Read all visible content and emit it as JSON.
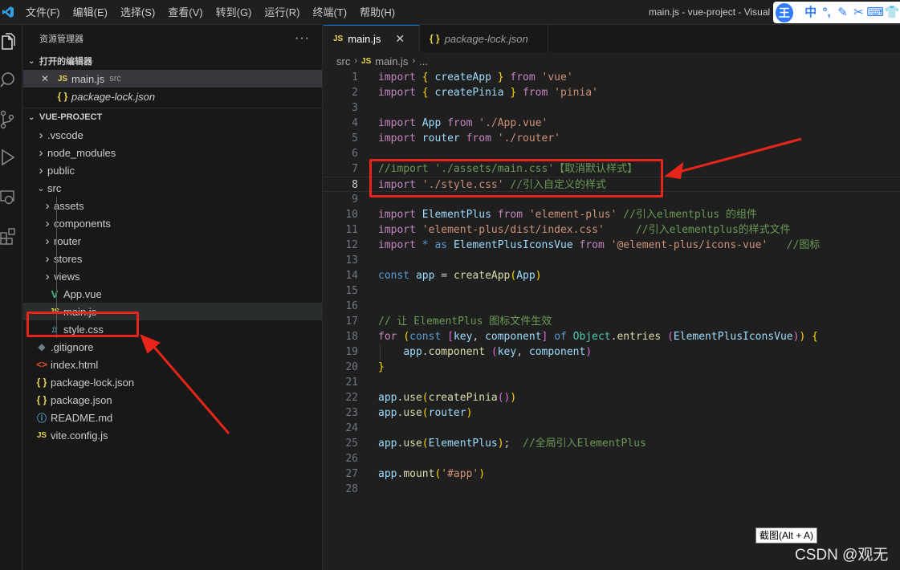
{
  "titlebar": {
    "menu": [
      "文件(F)",
      "编辑(E)",
      "选择(S)",
      "查看(V)",
      "转到(G)",
      "运行(R)",
      "终端(T)",
      "帮助(H)"
    ],
    "window_title": "main.js - vue-project - Visual S",
    "ime": {
      "logo": "王",
      "buttons": [
        "中",
        "°,",
        "✎",
        "✂",
        "⌨",
        "👕"
      ]
    }
  },
  "activitybar": {
    "icons": [
      "explorer-icon",
      "search-icon",
      "source-control-icon",
      "run-debug-icon",
      "remote-explorer-icon",
      "extensions-icon"
    ]
  },
  "sidebar": {
    "title": "资源管理器",
    "more": "···",
    "open_editors": {
      "label": "打开的编辑器",
      "items": [
        {
          "close": "✕",
          "icon": "JS",
          "name": "main.js",
          "desc": "src"
        },
        {
          "icon": "{ }",
          "name": "package-lock.json"
        }
      ]
    },
    "project": {
      "label": "VUE-PROJECT",
      "items": [
        {
          "name": ".vscode",
          "type": "folder",
          "depth": 0
        },
        {
          "name": "node_modules",
          "type": "folder",
          "depth": 0
        },
        {
          "name": "public",
          "type": "folder",
          "depth": 0
        },
        {
          "name": "src",
          "type": "folder-open",
          "depth": 0
        },
        {
          "name": "assets",
          "type": "folder",
          "depth": 1
        },
        {
          "name": "components",
          "type": "folder",
          "depth": 1
        },
        {
          "name": "router",
          "type": "folder",
          "depth": 1
        },
        {
          "name": "stores",
          "type": "folder",
          "depth": 1
        },
        {
          "name": "views",
          "type": "folder",
          "depth": 1
        },
        {
          "name": "App.vue",
          "type": "vue",
          "depth": 1
        },
        {
          "name": "main.js",
          "type": "js",
          "depth": 1
        },
        {
          "name": "style.css",
          "type": "css",
          "depth": 1
        },
        {
          "name": ".gitignore",
          "type": "git",
          "depth": 0
        },
        {
          "name": "index.html",
          "type": "html",
          "depth": 0
        },
        {
          "name": "package-lock.json",
          "type": "json",
          "depth": 0
        },
        {
          "name": "package.json",
          "type": "json",
          "depth": 0
        },
        {
          "name": "README.md",
          "type": "info",
          "depth": 0
        },
        {
          "name": "vite.config.js",
          "type": "js",
          "depth": 0
        }
      ]
    }
  },
  "editor": {
    "tabs": [
      {
        "icon": "JS",
        "label": "main.js",
        "close": "✕"
      },
      {
        "icon": "{ }",
        "label": "package-lock.json"
      }
    ],
    "breadcrumb": {
      "folder": "src",
      "icon": "JS",
      "file": "main.js",
      "more": "..."
    },
    "current_line": 8,
    "lines": [
      [
        [
          "kw",
          "import"
        ],
        [
          "pun",
          " "
        ],
        [
          "br1",
          "{"
        ],
        [
          "pun",
          " "
        ],
        [
          "id",
          "createApp"
        ],
        [
          "pun",
          " "
        ],
        [
          "br1",
          "}"
        ],
        [
          "pun",
          " "
        ],
        [
          "kw",
          "from"
        ],
        [
          "pun",
          " "
        ],
        [
          "str",
          "'vue'"
        ]
      ],
      [
        [
          "kw",
          "import"
        ],
        [
          "pun",
          " "
        ],
        [
          "br1",
          "{"
        ],
        [
          "pun",
          " "
        ],
        [
          "id",
          "createPinia"
        ],
        [
          "pun",
          " "
        ],
        [
          "br1",
          "}"
        ],
        [
          "pun",
          " "
        ],
        [
          "kw",
          "from"
        ],
        [
          "pun",
          " "
        ],
        [
          "str",
          "'pinia'"
        ]
      ],
      [],
      [
        [
          "kw",
          "import"
        ],
        [
          "pun",
          " "
        ],
        [
          "id",
          "App"
        ],
        [
          "pun",
          " "
        ],
        [
          "kw",
          "from"
        ],
        [
          "pun",
          " "
        ],
        [
          "str",
          "'./App.vue'"
        ]
      ],
      [
        [
          "kw",
          "import"
        ],
        [
          "pun",
          " "
        ],
        [
          "id",
          "router"
        ],
        [
          "pun",
          " "
        ],
        [
          "kw",
          "from"
        ],
        [
          "pun",
          " "
        ],
        [
          "str",
          "'./router'"
        ]
      ],
      [],
      [
        [
          "cmt",
          "//import './assets/main.css'【取消默认样式】"
        ]
      ],
      [
        [
          "kw",
          "import"
        ],
        [
          "pun",
          " "
        ],
        [
          "str",
          "'./style.css'"
        ],
        [
          "pun",
          " "
        ],
        [
          "cmt",
          "//引入自定义的样式"
        ]
      ],
      [],
      [
        [
          "kw",
          "import"
        ],
        [
          "pun",
          " "
        ],
        [
          "id",
          "ElementPlus"
        ],
        [
          "pun",
          " "
        ],
        [
          "kw",
          "from"
        ],
        [
          "pun",
          " "
        ],
        [
          "str",
          "'element-plus'"
        ],
        [
          "pun",
          " "
        ],
        [
          "cmt",
          "//引入elmentplus 的组件"
        ]
      ],
      [
        [
          "kw",
          "import"
        ],
        [
          "pun",
          " "
        ],
        [
          "str",
          "'element-plus/dist/index.css'"
        ],
        [
          "pun",
          "     "
        ],
        [
          "cmt",
          "//引入elementplus的样式文件"
        ]
      ],
      [
        [
          "kw",
          "import"
        ],
        [
          "pun",
          " "
        ],
        [
          "kw2",
          "*"
        ],
        [
          "pun",
          " "
        ],
        [
          "kw2",
          "as"
        ],
        [
          "pun",
          " "
        ],
        [
          "id",
          "ElementPlusIconsVue"
        ],
        [
          "pun",
          " "
        ],
        [
          "kw",
          "from"
        ],
        [
          "pun",
          " "
        ],
        [
          "str",
          "'@element-plus/icons-vue'"
        ],
        [
          "pun",
          "   "
        ],
        [
          "cmt",
          "//图标"
        ]
      ],
      [],
      [
        [
          "kw2",
          "const"
        ],
        [
          "pun",
          " "
        ],
        [
          "id",
          "app"
        ],
        [
          "pun",
          " = "
        ],
        [
          "fn",
          "createApp"
        ],
        [
          "br1",
          "("
        ],
        [
          "id",
          "App"
        ],
        [
          "br1",
          ")"
        ]
      ],
      [],
      [],
      [
        [
          "cmt",
          "// 让 ElementPlus 图标文件生效"
        ]
      ],
      [
        [
          "kw",
          "for"
        ],
        [
          "pun",
          " "
        ],
        [
          "br1",
          "("
        ],
        [
          "kw2",
          "const"
        ],
        [
          "pun",
          " "
        ],
        [
          "br2",
          "["
        ],
        [
          "id",
          "key"
        ],
        [
          "pun",
          ", "
        ],
        [
          "id",
          "component"
        ],
        [
          "br2",
          "]"
        ],
        [
          "pun",
          " "
        ],
        [
          "kw2",
          "of"
        ],
        [
          "pun",
          " "
        ],
        [
          "cls",
          "Object"
        ],
        [
          "pun",
          "."
        ],
        [
          "fn",
          "entries"
        ],
        [
          "pun",
          " "
        ],
        [
          "br2",
          "("
        ],
        [
          "id",
          "ElementPlusIconsVue"
        ],
        [
          "br2",
          ")"
        ],
        [
          "br1",
          ")"
        ],
        [
          "pun",
          " "
        ],
        [
          "br1",
          "{"
        ]
      ],
      [
        [
          "pun",
          "    "
        ],
        [
          "id",
          "app"
        ],
        [
          "pun",
          "."
        ],
        [
          "fn",
          "component"
        ],
        [
          "pun",
          " "
        ],
        [
          "br2",
          "("
        ],
        [
          "id",
          "key"
        ],
        [
          "pun",
          ", "
        ],
        [
          "id",
          "component"
        ],
        [
          "br2",
          ")"
        ]
      ],
      [
        [
          "br1",
          "}"
        ]
      ],
      [],
      [
        [
          "id",
          "app"
        ],
        [
          "pun",
          "."
        ],
        [
          "fn",
          "use"
        ],
        [
          "br1",
          "("
        ],
        [
          "fn",
          "createPinia"
        ],
        [
          "br2",
          "()"
        ],
        [
          "br1",
          ")"
        ]
      ],
      [
        [
          "id",
          "app"
        ],
        [
          "pun",
          "."
        ],
        [
          "fn",
          "use"
        ],
        [
          "br1",
          "("
        ],
        [
          "id",
          "router"
        ],
        [
          "br1",
          ")"
        ]
      ],
      [],
      [
        [
          "id",
          "app"
        ],
        [
          "pun",
          "."
        ],
        [
          "fn",
          "use"
        ],
        [
          "br1",
          "("
        ],
        [
          "id",
          "ElementPlus"
        ],
        [
          "br1",
          ")"
        ],
        [
          "pun",
          ";  "
        ],
        [
          "cmt",
          "//全局引入ElementPlus"
        ]
      ],
      [],
      [
        [
          "id",
          "app"
        ],
        [
          "pun",
          "."
        ],
        [
          "fn",
          "mount"
        ],
        [
          "br1",
          "("
        ],
        [
          "str",
          "'#app'"
        ],
        [
          "br1",
          ")"
        ]
      ],
      []
    ]
  },
  "overlay": {
    "tooltip": "截图(Alt + A)",
    "watermark": "CSDN @观无"
  },
  "colors": {
    "accent": "#0078d4",
    "annotation_red": "#e8251b",
    "js_yellow": "#e8d44d",
    "vue_green": "#41b883",
    "css_blue": "#519aba"
  }
}
